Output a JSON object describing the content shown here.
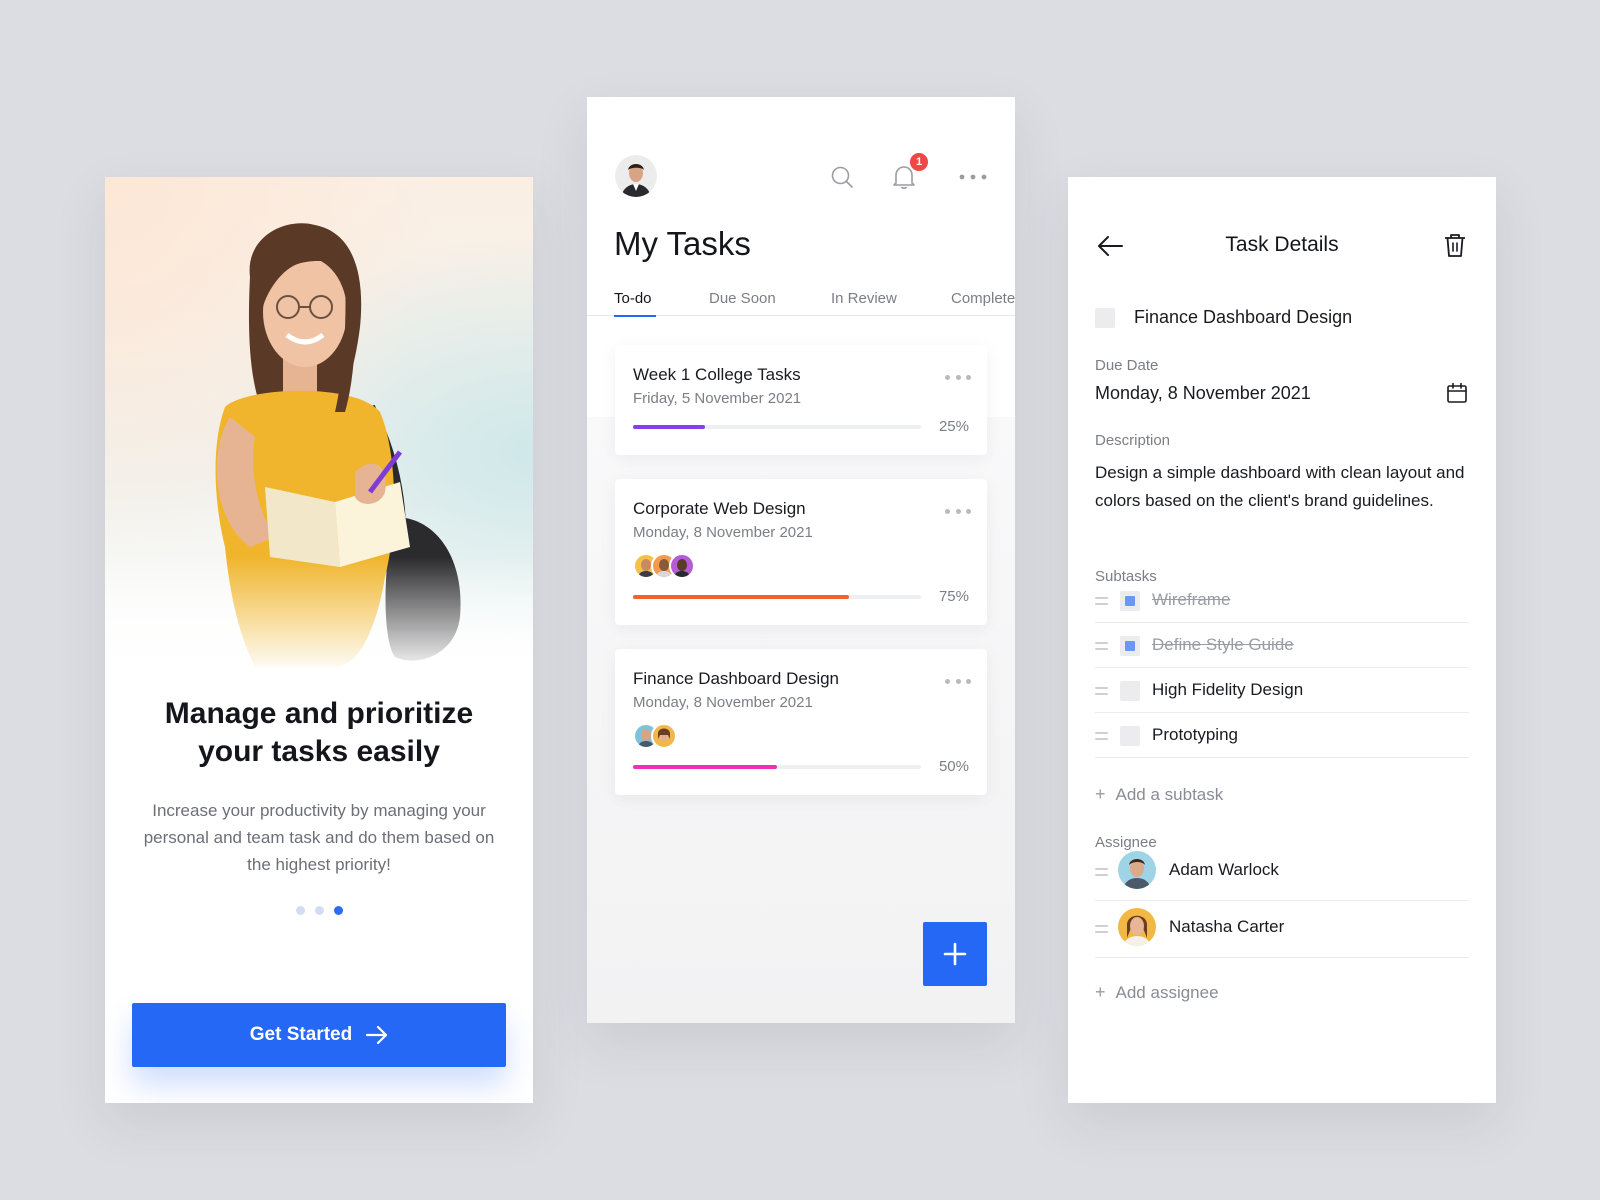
{
  "onboarding": {
    "title_line1": "Manage and prioritize",
    "title_line2": "your tasks easily",
    "subtitle": "Increase your productivity by managing your personal and team task and do them based on the highest priority!",
    "pagination": {
      "total": 3,
      "active": 3
    },
    "cta_label": "Get Started",
    "accent": "#2468f5"
  },
  "tasks": {
    "title": "My Tasks",
    "notification_count": "1",
    "tabs": [
      {
        "label": "To-do",
        "active": true
      },
      {
        "label": "Due Soon",
        "active": false
      },
      {
        "label": "In Review",
        "active": false
      },
      {
        "label": "Complete",
        "active": false
      }
    ],
    "cards": [
      {
        "title": "Week 1 College Tasks",
        "date": "Friday, 5 November 2021",
        "progress": 25,
        "progress_label": "25%",
        "color": "#8a3cf0",
        "assignees": 0
      },
      {
        "title": "Corporate Web Design",
        "date": "Monday, 8 November 2021",
        "progress": 75,
        "progress_label": "75%",
        "color": "#f2632a",
        "assignees": 3
      },
      {
        "title": "Finance Dashboard Design",
        "date": "Monday, 8 November 2021",
        "progress": 50,
        "progress_label": "50%",
        "color": "#ef2fb8",
        "assignees": 2
      }
    ]
  },
  "details": {
    "title": "Task Details",
    "task_name": "Finance Dashboard Design",
    "due_label": "Due Date",
    "due_value": "Monday, 8 November 2021",
    "description_label": "Description",
    "description": "Design a simple dashboard with clean layout and colors based on the client's brand guidelines.",
    "subtasks_label": "Subtasks",
    "subtasks": [
      {
        "label": "Wireframe",
        "done": true
      },
      {
        "label": "Define Style Guide",
        "done": true
      },
      {
        "label": "High Fidelity Design",
        "done": false
      },
      {
        "label": "Prototyping",
        "done": false
      }
    ],
    "add_subtask": "Add a subtask",
    "assignee_label": "Assignee",
    "assignees": [
      {
        "name": "Adam Warlock"
      },
      {
        "name": "Natasha Carter"
      }
    ],
    "add_assignee": "Add assignee"
  }
}
